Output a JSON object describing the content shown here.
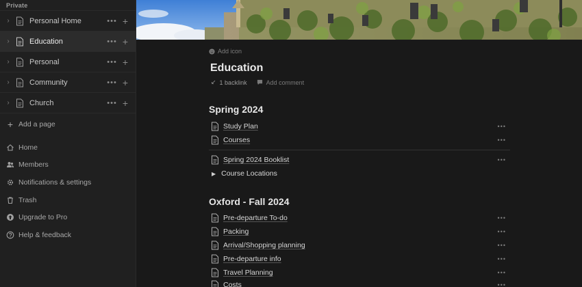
{
  "sidebar": {
    "section_label": "Private",
    "pages": [
      {
        "label": "Personal Home",
        "active": false
      },
      {
        "label": "Education",
        "active": true
      },
      {
        "label": "Personal",
        "active": false
      },
      {
        "label": "Community",
        "active": false
      },
      {
        "label": "Church",
        "active": false
      }
    ],
    "add_page_label": "Add a page",
    "nav": [
      {
        "label": "Home",
        "icon": "home-icon"
      },
      {
        "label": "Members",
        "icon": "members-icon"
      },
      {
        "label": "Notifications & settings",
        "icon": "gear-icon"
      },
      {
        "label": "Trash",
        "icon": "trash-icon"
      },
      {
        "label": "Upgrade to Pro",
        "icon": "upgrade-icon"
      },
      {
        "label": "Help & feedback",
        "icon": "help-icon"
      }
    ]
  },
  "page": {
    "add_icon_label": "Add icon",
    "title": "Education",
    "backlinks_label": "1 backlink",
    "add_comment_label": "Add comment",
    "sections": [
      {
        "heading": "Spring 2024",
        "links": [
          "Study Plan",
          "Courses"
        ],
        "links_after_divider": [
          "Spring 2024 Booklist"
        ],
        "toggle": "Course Locations"
      },
      {
        "heading": "Oxford - Fall 2024",
        "links": [
          "Pre-departure To-do",
          "Packing",
          "Arrival/Shopping planning",
          "Pre-departure info",
          "Travel Planning",
          "Costs"
        ]
      }
    ]
  },
  "colors": {
    "background": "#191919",
    "sidebar": "#202020",
    "active_row": "#2c2c2c"
  }
}
